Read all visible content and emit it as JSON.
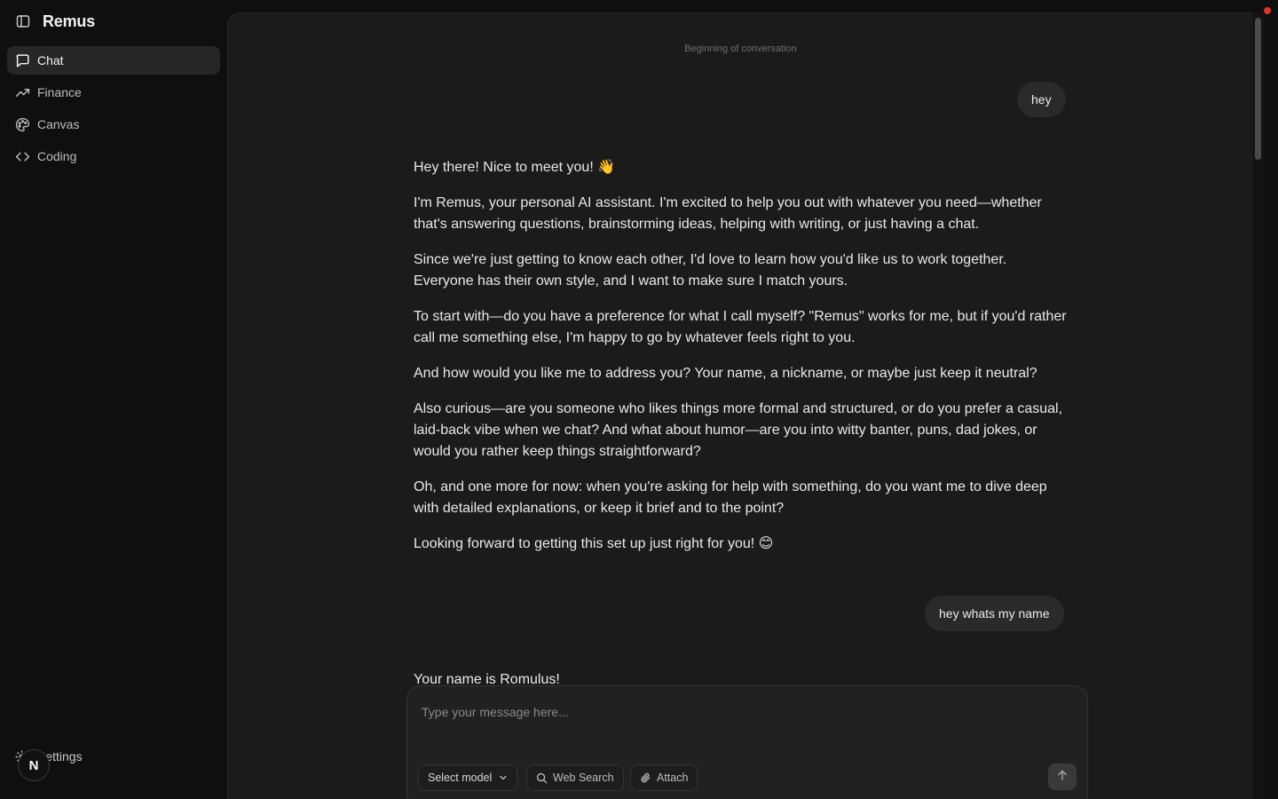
{
  "app": {
    "title": "Remus"
  },
  "sidebar": {
    "items": [
      {
        "label": "Chat",
        "icon": "chat-bubble-icon",
        "active": true
      },
      {
        "label": "Finance",
        "icon": "trending-up-icon",
        "active": false
      },
      {
        "label": "Canvas",
        "icon": "palette-icon",
        "active": false
      },
      {
        "label": "Coding",
        "icon": "code-icon",
        "active": false
      }
    ],
    "settings_label": "Settings",
    "avatar_initial": "N"
  },
  "conversation": {
    "beginning_label": "Beginning of conversation",
    "messages": [
      {
        "role": "user",
        "text": "hey"
      },
      {
        "role": "assistant",
        "paragraphs": [
          "Hey there! Nice to meet you! 👋",
          "I'm Remus, your personal AI assistant. I'm excited to help you out with whatever you need—whether that's answering questions, brainstorming ideas, helping with writing, or just having a chat.",
          "Since we're just getting to know each other, I'd love to learn how you'd like us to work together. Everyone has their own style, and I want to make sure I match yours.",
          "To start with—do you have a preference for what I call myself? \"Remus\" works for me, but if you'd rather call me something else, I'm happy to go by whatever feels right to you.",
          "And how would you like me to address you? Your name, a nickname, or maybe just keep it neutral?",
          "Also curious—are you someone who likes things more formal and structured, or do you prefer a casual, laid-back vibe when we chat? And what about humor—are you into witty banter, puns, dad jokes, or would you rather keep things straightforward?",
          "Oh, and one more for now: when you're asking for help with something, do you want me to dive deep with detailed explanations, or keep it brief and to the point?",
          "Looking forward to getting this set up just right for you! 😊"
        ]
      },
      {
        "role": "user",
        "text": "hey whats my name"
      },
      {
        "role": "assistant",
        "text": "Your name is Romulus!"
      }
    ]
  },
  "composer": {
    "placeholder": "Type your message here...",
    "model_label": "Select model",
    "web_search_label": "Web Search",
    "attach_label": "Attach"
  },
  "colors": {
    "sidebar_bg": "#0f0f0f",
    "panel_bg": "#1b1b1b",
    "active_item_bg": "#262626",
    "record_dot": "#e0322b"
  }
}
